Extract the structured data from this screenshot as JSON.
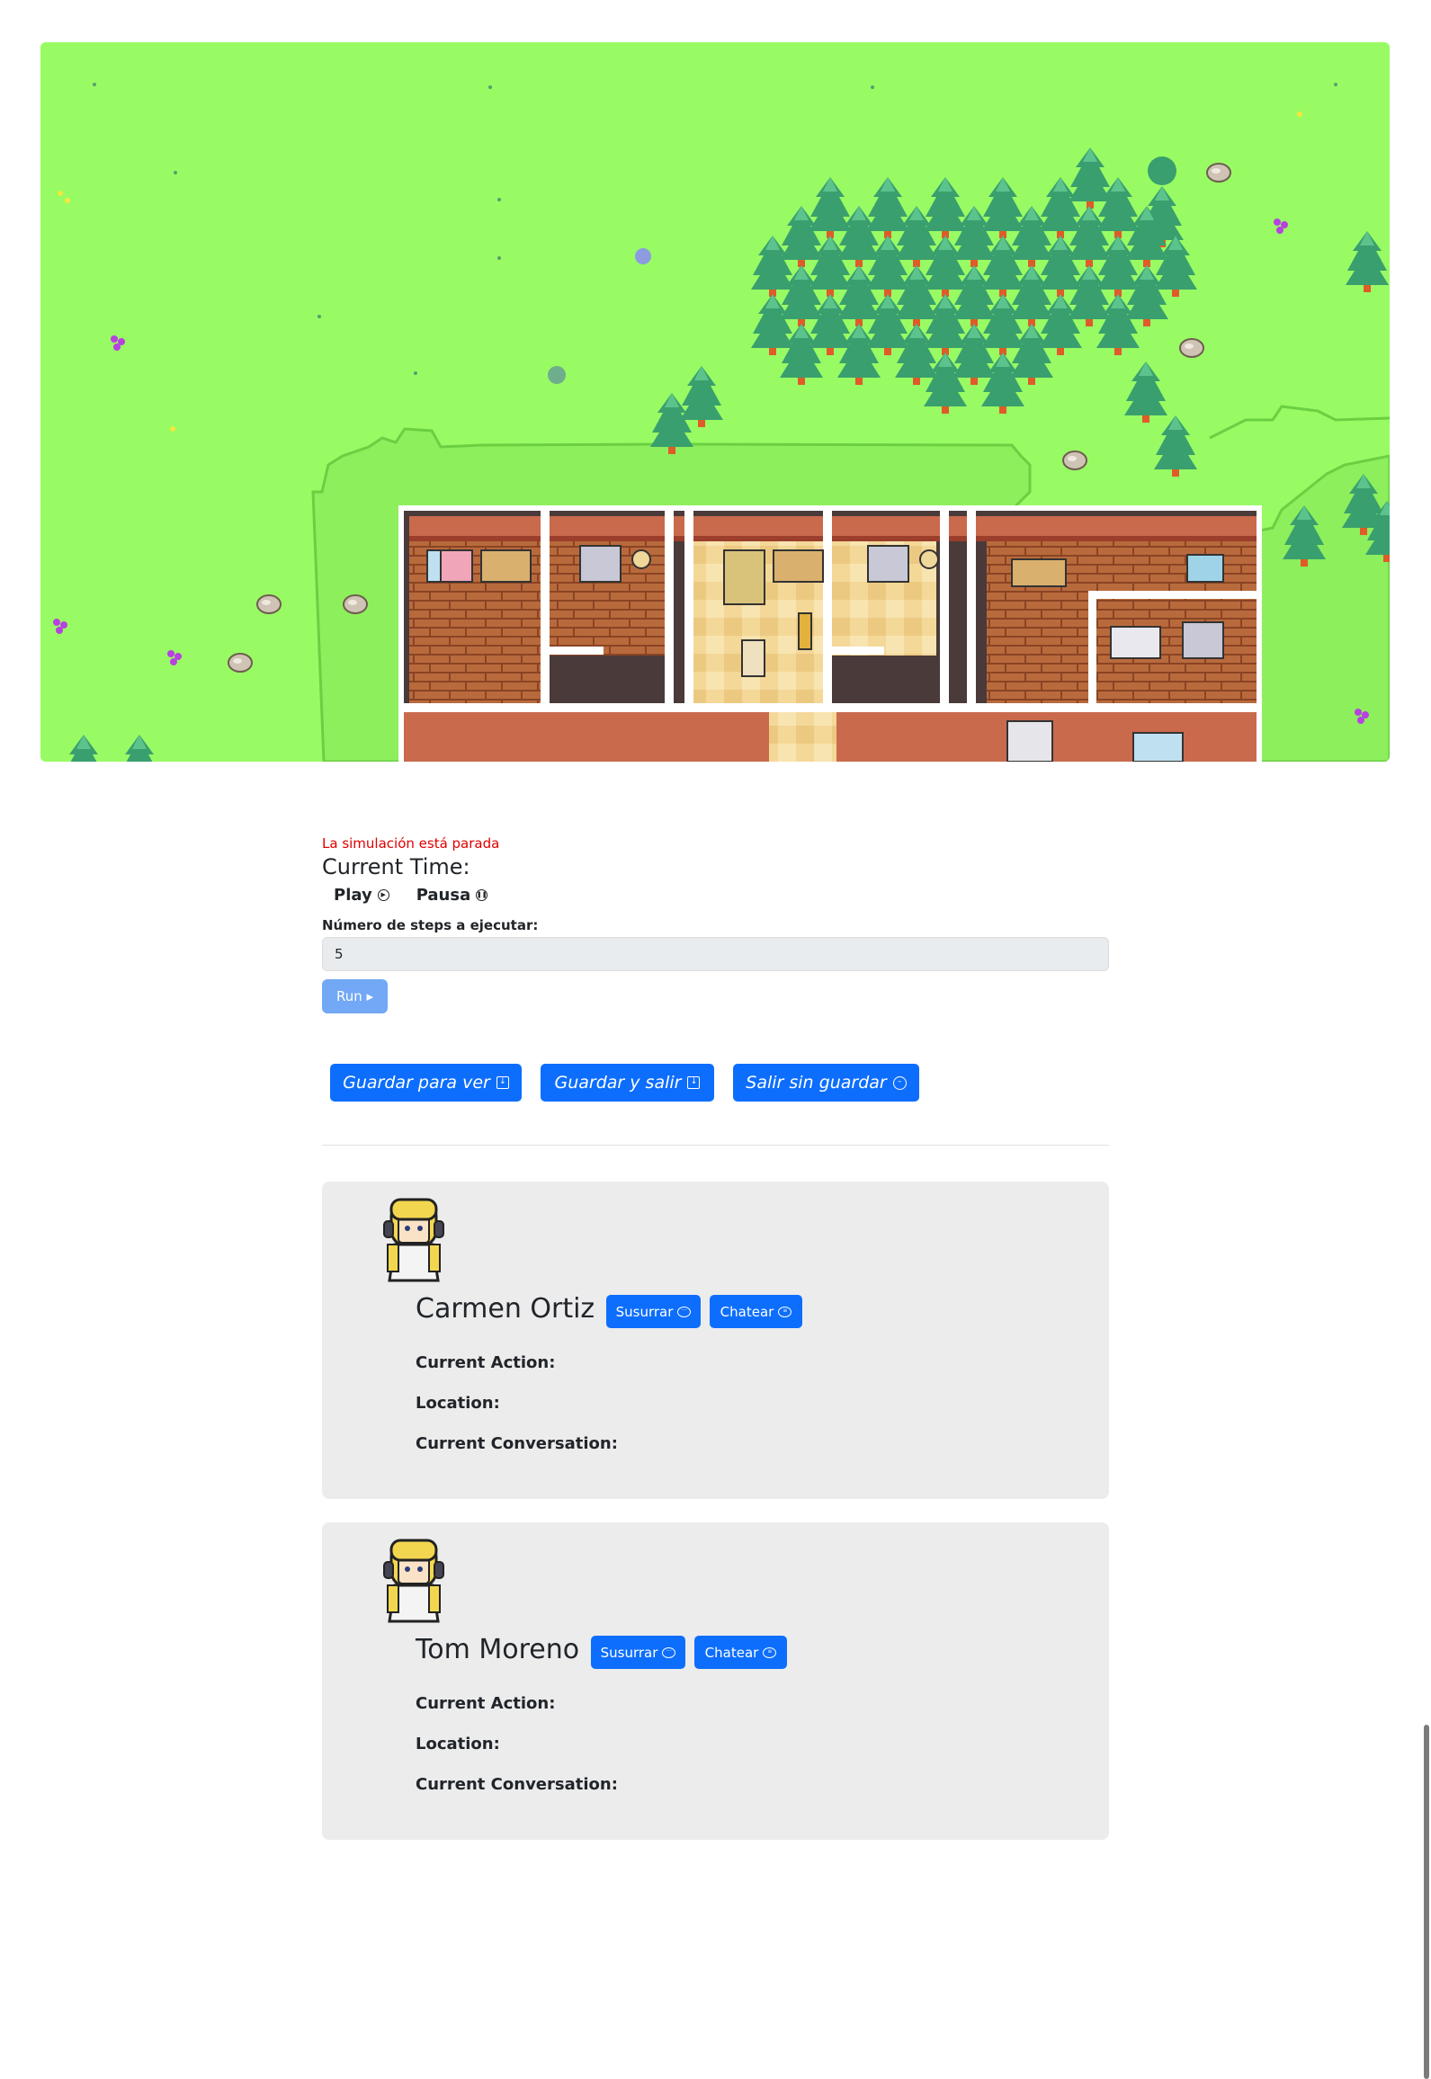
{
  "sim": {
    "status": "La simulación está parada",
    "current_time_label": "Current Time:",
    "play_label": "Play",
    "pause_label": "Pausa",
    "steps_label": "Número de steps a ejecutar:",
    "steps_value": "5",
    "run_label": "Run ▸"
  },
  "actions": {
    "save_view": "Guardar para ver",
    "save_exit": "Guardar y salir",
    "exit_no_save": "Salir sin guardar"
  },
  "personas": [
    {
      "name": "Carmen Ortiz",
      "whisper_label": "Susurrar",
      "chat_label": "Chatear",
      "current_action_label": "Current Action:",
      "location_label": "Location:",
      "conversation_label": "Current Conversation:"
    },
    {
      "name": "Tom Moreno",
      "whisper_label": "Susurrar",
      "chat_label": "Chatear",
      "current_action_label": "Current Action:",
      "location_label": "Location:",
      "conversation_label": "Current Conversation:"
    }
  ],
  "colors": {
    "grass": "#98fb64",
    "button_primary": "#0d6efd",
    "button_disabled": "#72a8f5",
    "status_text": "#e00000",
    "card_bg": "#ececed"
  },
  "icons": {
    "play": "play-circle-icon",
    "pause": "pause-circle-icon",
    "save": "download-square-icon",
    "exit": "minus-circle-icon",
    "whisper": "chat-bubble-icon",
    "chat": "chat-text-icon"
  }
}
